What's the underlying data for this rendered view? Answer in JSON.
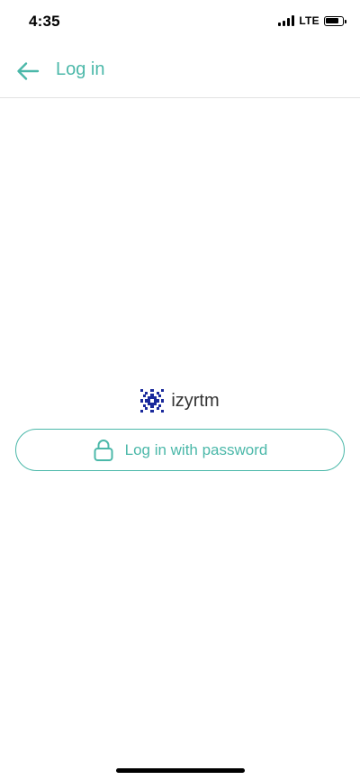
{
  "status_bar": {
    "time": "4:35",
    "network": "LTE",
    "signal_bars": 4,
    "battery_level": 0.8,
    "icons": [
      "signal-icon",
      "battery-icon"
    ]
  },
  "header": {
    "title": "Log in",
    "back_icon": "arrow-left-icon"
  },
  "organization": {
    "name": "izyrtm",
    "logo_icon": "pattern-logo"
  },
  "login_button": {
    "label": "Log in with password",
    "icon": "lock-icon"
  },
  "colors": {
    "accent": "#4bb8a9",
    "divider": "#e2e2e2",
    "logo": "#1a2a9c",
    "text": "#333333"
  }
}
